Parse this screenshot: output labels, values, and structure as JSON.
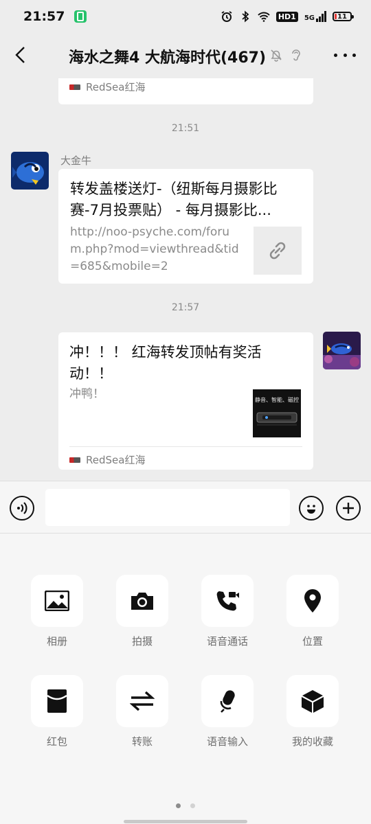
{
  "status_bar": {
    "time": "21:57",
    "network": "5G",
    "hd": "HD1",
    "battery_percent": "11"
  },
  "header": {
    "title": "海水之舞4 大航海时代(467)"
  },
  "chat": {
    "top_card_source": "RedSea红海",
    "time_1": "21:51",
    "msg1": {
      "sender": "大金牛",
      "title": "转发盖楼送灯-（纽斯每月摄影比赛-7月投票贴） - 每月摄影比...",
      "url": "http://noo-psyche.com/forum.php?mod=viewthread&tid=685&mobile=2"
    },
    "time_2": "21:57",
    "msg2": {
      "title": "冲！！！ 红海转发顶帖有奖活动！！",
      "desc": "冲鸭！",
      "thumb_text": "静音、智能、磁控",
      "source": "RedSea红海"
    }
  },
  "input": {
    "value": "",
    "placeholder": ""
  },
  "tools": [
    {
      "label": "相册",
      "icon": "photo-album-icon"
    },
    {
      "label": "拍摄",
      "icon": "camera-icon"
    },
    {
      "label": "语音通话",
      "icon": "video-call-icon"
    },
    {
      "label": "位置",
      "icon": "location-icon"
    },
    {
      "label": "红包",
      "icon": "red-packet-icon"
    },
    {
      "label": "转账",
      "icon": "transfer-icon"
    },
    {
      "label": "语音输入",
      "icon": "voice-input-icon"
    },
    {
      "label": "我的收藏",
      "icon": "favorites-icon"
    }
  ],
  "pager": {
    "current": 1,
    "total": 2
  }
}
